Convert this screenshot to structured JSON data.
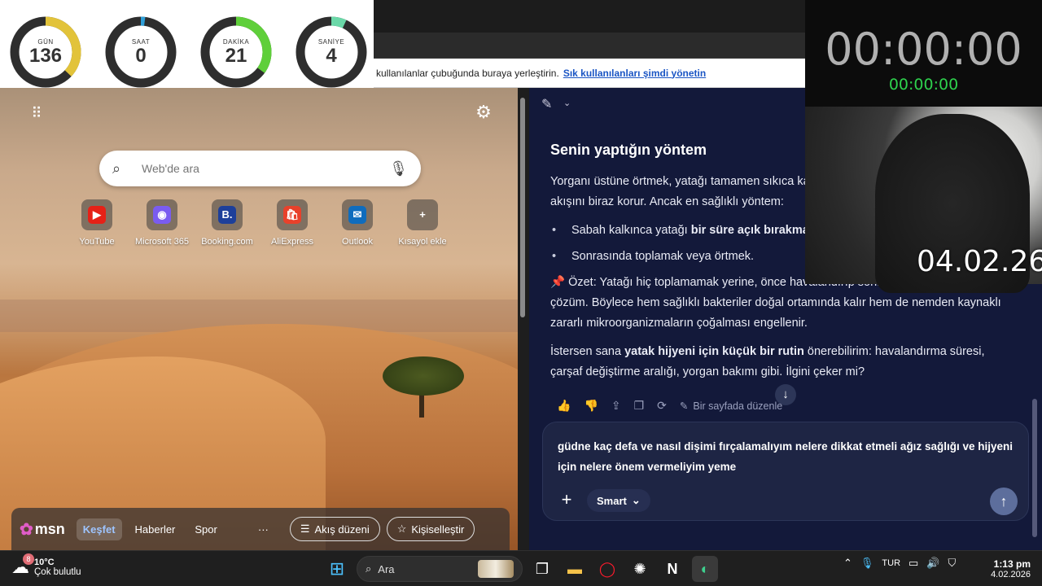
{
  "countdown": [
    {
      "label": "GÜN",
      "value": "136",
      "fraction": 0.37,
      "color": "#e2c33a"
    },
    {
      "label": "SAAT",
      "value": "0",
      "fraction": 0.02,
      "color": "#2f9fd8"
    },
    {
      "label": "DAKİKA",
      "value": "21",
      "fraction": 0.35,
      "color": "#5fcf3a"
    },
    {
      "label": "SANİYE",
      "value": "4",
      "fraction": 0.07,
      "color": "#6bd8a8"
    }
  ],
  "favorites_bar": {
    "text": "kullanılanlar çubuğunda buraya yerleştirin.",
    "link": "Sık kullanılanları şimdi yönetin"
  },
  "ntp": {
    "search_placeholder": "Web'de ara",
    "quick_links": [
      {
        "label": "YouTube",
        "icon": "youtube-icon",
        "color": "#e62117",
        "glyph": "▶"
      },
      {
        "label": "Microsoft 365",
        "icon": "microsoft365-icon",
        "color": "#7a5cf0",
        "glyph": "◉"
      },
      {
        "label": "Booking.com",
        "icon": "booking-icon",
        "color": "#1d3f9a",
        "glyph": "B."
      },
      {
        "label": "AliExpress",
        "icon": "aliexpress-icon",
        "color": "#e8412b",
        "glyph": "🛍"
      },
      {
        "label": "Outlook",
        "icon": "outlook-icon",
        "color": "#0f6cbd",
        "glyph": "✉"
      },
      {
        "label": "Kısayol ekle",
        "icon": "add-shortcut-icon",
        "color": "transparent",
        "glyph": "+"
      }
    ],
    "msn": {
      "logo": "msn",
      "tabs": [
        "Keşfet",
        "Haberler",
        "Spor"
      ],
      "more": "···",
      "feed_layout": "Akış düzeni",
      "personalize": "Kişiselleştir"
    }
  },
  "copilot": {
    "heading": "Senin yaptığın yöntem",
    "para1": "Yorganı üstüne örtmek, yatağı tamamen sıkıca kapatmaktan daha iyidir çünkü hava akışını biraz korur. Ancak en sağlıklı yöntem:",
    "bullet1_pre": "Sabah kalkınca yatağı ",
    "bullet1_bold": "bir süre açık bırakmak",
    "bullet2": "Sonrasında toplamak veya örtmek.",
    "summary_pin": "📌",
    "summary": "Özet: Yatağı hiç toplamamak yerine, önce havalandırıp sonra örtmek daha dengeli bir çözüm. Böylece hem sağlıklı bakteriler doğal ortamında kalır hem de nemden kaynaklı zararlı mikroorganizmaların çoğalması engellenir.",
    "offer_pre": "İstersen sana ",
    "offer_bold": "yatak hijyeni için küçük bir rutin",
    "offer_post": " önerebilirim: havalandırma süresi, çarşaf değiştirme aralığı, yorgan bakımı gibi. İlgini çeker mi?",
    "edit_label": "Bir sayfada düzenle",
    "typed": "güdne kaç defa ve nasıl dişimi fırçalamalıyım nelere dikkat etmeli ağız sağlığı ve hijyeni için nelere önem vermeliyim yeme",
    "mode": "Smart"
  },
  "timer": {
    "main": "00:00:00",
    "sub": "00:00:00"
  },
  "webcam_date": "04.02.26",
  "taskbar": {
    "weather_badge": "8",
    "temp": "10°C",
    "condition": "Çok bulutlu",
    "search": "Ara",
    "lang": "TUR",
    "time": "1:13 pm",
    "date": "4.02.2026"
  }
}
